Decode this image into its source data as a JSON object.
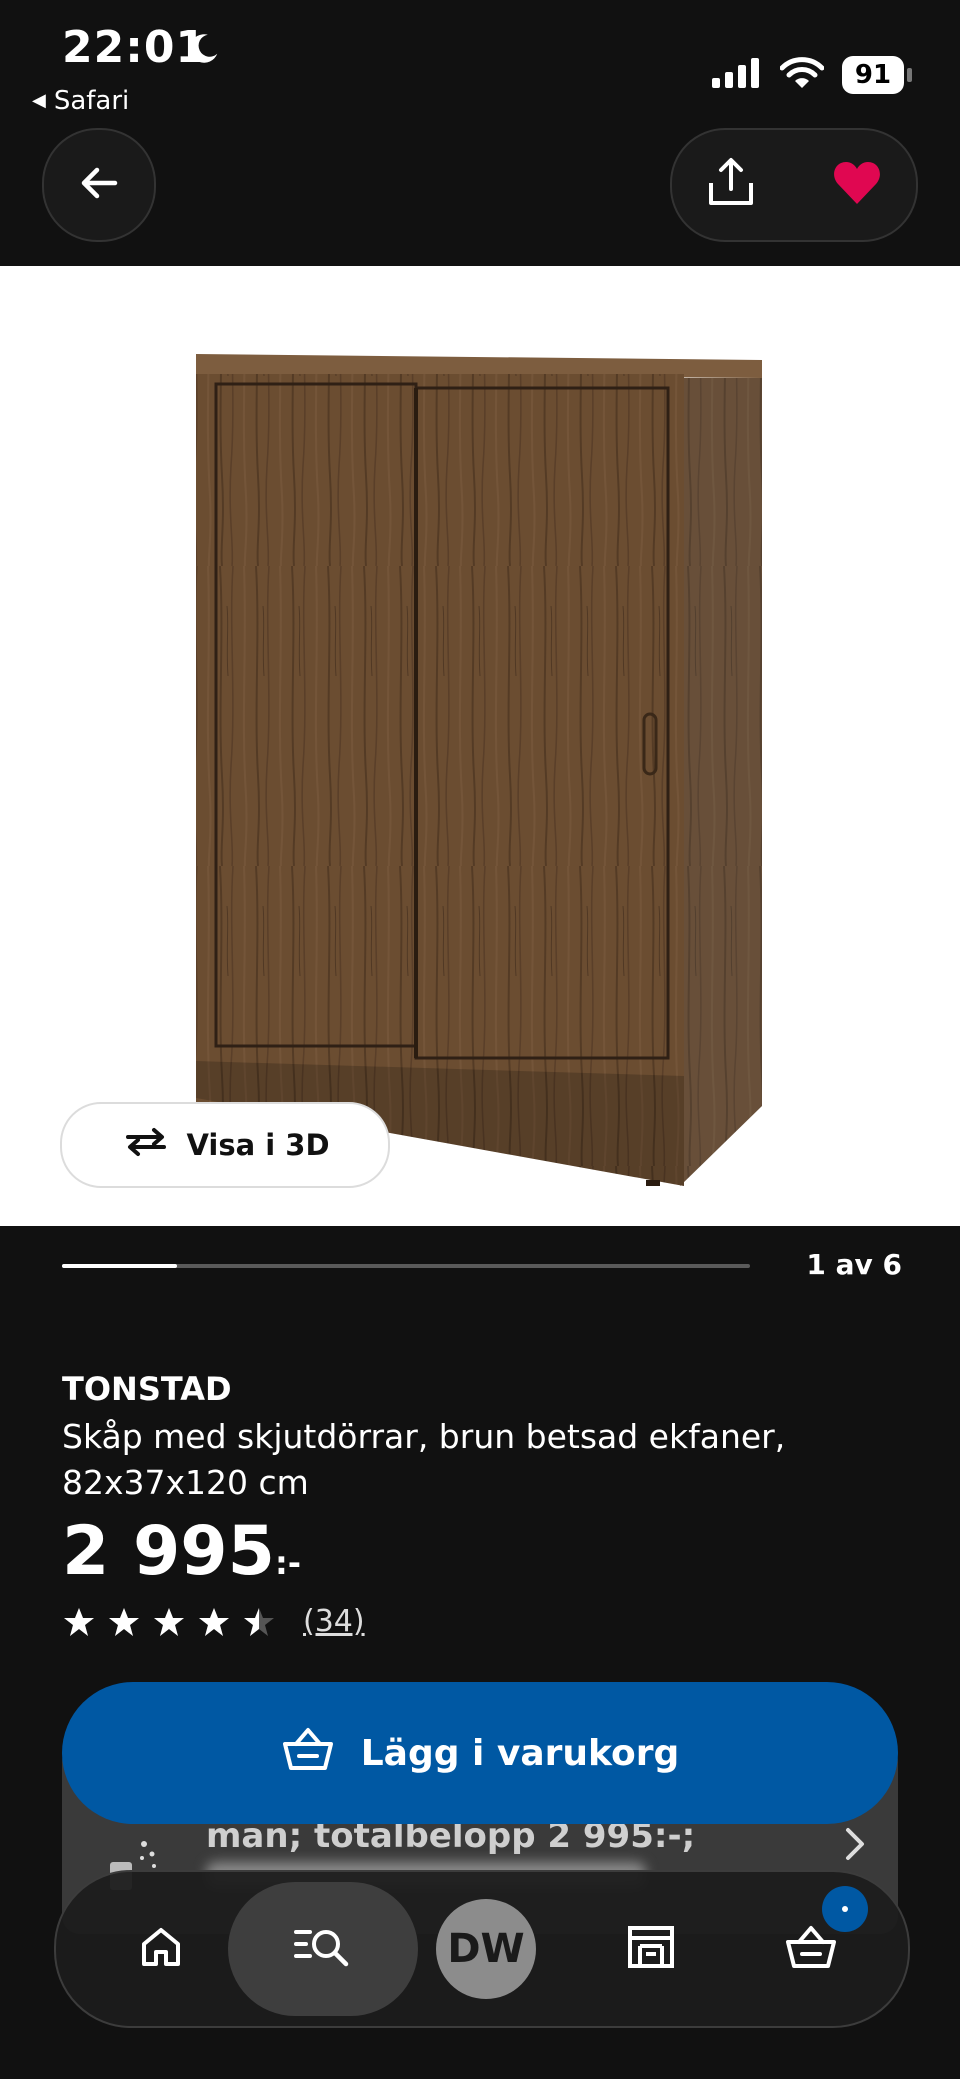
{
  "status_bar": {
    "time": "22:01",
    "back_app": "Safari",
    "battery": "91"
  },
  "icons": {
    "back": "arrow-left-icon",
    "share": "share-icon",
    "favorite": "heart-icon",
    "rotate": "rotate-3d-icon",
    "cart": "basket-icon",
    "home": "home-icon",
    "search": "search-list-icon",
    "store": "store-icon"
  },
  "colors": {
    "accent": "#0058a3",
    "heart": "#e00751",
    "background": "#111111"
  },
  "gallery": {
    "view_3d_label": "Visa i 3D",
    "page_indicator": "1 av 6",
    "current_page": 1,
    "total_pages": 6
  },
  "product": {
    "name": "TONSTAD",
    "description": "Skåp med skjutdörrar, brun betsad ekfaner, 82x37x120 cm",
    "price": "2 995",
    "price_suffix": ":-",
    "rating": 4.5,
    "rating_max": 5,
    "rating_count": "(34)"
  },
  "promo": {
    "text": "man; totalbelopp 2 995:-;"
  },
  "actions": {
    "add_to_cart": "Lägg i varukorg"
  },
  "tab_bar": {
    "avatar_initials": "DW"
  }
}
